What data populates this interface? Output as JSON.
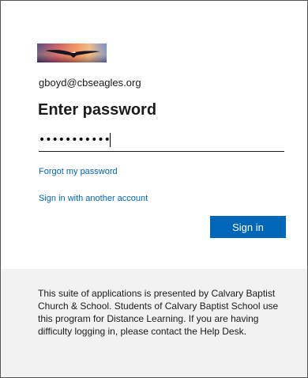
{
  "account": {
    "email": "gboyd@cbseagles.org"
  },
  "form": {
    "title": "Enter password",
    "password_masked": "•••••••••••",
    "forgot_link": "Forgot my password",
    "other_account_link": "Sign in with another account",
    "signin_label": "Sign in"
  },
  "footer": {
    "text": "This suite of applications is presented by Calvary Baptist Church & School. Students of Calvary Baptist School use this program for Distance Learning. If you are having difficulty logging in, please contact the Help Desk."
  },
  "colors": {
    "accent": "#0067b8",
    "footer_bg": "#f2f2f2",
    "text": "#1b1b1b"
  },
  "icons": {
    "banner": "eagle-sunset-banner"
  }
}
